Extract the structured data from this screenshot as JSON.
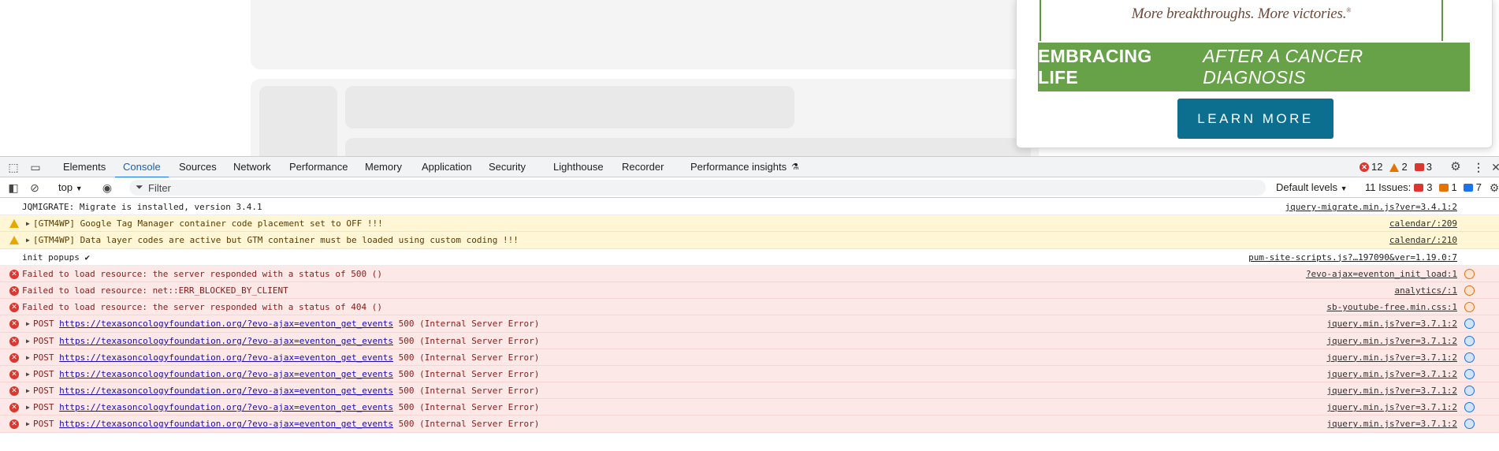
{
  "ad": {
    "tagline": "More breakthroughs. More victories.",
    "tagline_mark": "®",
    "banner_bold": "EMBRACING LIFE",
    "banner_italic": "AFTER A CANCER DIAGNOSIS",
    "cta": "LEARN MORE"
  },
  "devtools": {
    "tabs": [
      {
        "label": "Elements",
        "active": false
      },
      {
        "label": "Console",
        "active": true
      },
      {
        "label": "Sources",
        "active": false
      },
      {
        "label": "Network",
        "active": false
      },
      {
        "label": "Performance",
        "active": false
      },
      {
        "label": "Memory",
        "active": false
      },
      {
        "label": "Application",
        "active": false
      },
      {
        "label": "Security",
        "active": false
      },
      {
        "label": "Lighthouse",
        "active": false
      },
      {
        "label": "Recorder",
        "active": false
      },
      {
        "label": "Performance insights",
        "active": false
      }
    ],
    "counts": {
      "errors": "12",
      "warnings": "2",
      "messages": "3"
    },
    "toolbar": {
      "context": "top",
      "filter_placeholder": "Filter",
      "levels": "Default levels",
      "issues_label": "11 Issues:",
      "issues_red": "3",
      "issues_orange": "1",
      "issues_blue": "7"
    },
    "console": [
      {
        "level": "info",
        "expandable": false,
        "text": "JQMIGRATE: Migrate is installed, version 3.4.1",
        "source": "jquery-migrate.min.js?ver=3.4.1:2",
        "net": ""
      },
      {
        "level": "warn",
        "expandable": true,
        "text": "[GTM4WP] Google Tag Manager container code placement set to OFF !!!",
        "source": "calendar/:209",
        "net": ""
      },
      {
        "level": "warn",
        "expandable": true,
        "text": "[GTM4WP] Data layer codes are active but GTM container must be loaded using custom coding !!!",
        "source": "calendar/:210",
        "net": ""
      },
      {
        "level": "info",
        "expandable": false,
        "text": "init popups ✔",
        "source": "pum-site-scripts.js?…197090&ver=1.19.0:7",
        "net": ""
      },
      {
        "level": "error",
        "expandable": false,
        "text": "Failed to load resource: the server responded with a status of 500 ()",
        "source": "?evo-ajax=eventon_init_load:1",
        "net": "orange"
      },
      {
        "level": "error",
        "expandable": false,
        "text": "Failed to load resource: net::ERR_BLOCKED_BY_CLIENT",
        "source": "analytics/:1",
        "net": "orange"
      },
      {
        "level": "error",
        "expandable": false,
        "text": "Failed to load resource: the server responded with a status of 404 ()",
        "source": "sb-youtube-free.min.css:1",
        "net": "orange"
      },
      {
        "level": "error",
        "expandable": true,
        "method": "POST",
        "url": "https://texasoncologyfoundation.org/?evo-ajax=eventon_get_events",
        "status": "500 (Internal Server Error)",
        "source": "jquery.min.js?ver=3.7.1:2",
        "net": "blue"
      },
      {
        "level": "error",
        "expandable": true,
        "method": "POST",
        "url": "https://texasoncologyfoundation.org/?evo-ajax=eventon_get_events",
        "status": "500 (Internal Server Error)",
        "source": "jquery.min.js?ver=3.7.1:2",
        "net": "blue"
      },
      {
        "level": "error",
        "expandable": true,
        "method": "POST",
        "url": "https://texasoncologyfoundation.org/?evo-ajax=eventon_get_events",
        "status": "500 (Internal Server Error)",
        "source": "jquery.min.js?ver=3.7.1:2",
        "net": "blue"
      },
      {
        "level": "error",
        "expandable": true,
        "method": "POST",
        "url": "https://texasoncologyfoundation.org/?evo-ajax=eventon_get_events",
        "status": "500 (Internal Server Error)",
        "source": "jquery.min.js?ver=3.7.1:2",
        "net": "blue"
      },
      {
        "level": "error",
        "expandable": true,
        "method": "POST",
        "url": "https://texasoncologyfoundation.org/?evo-ajax=eventon_get_events",
        "status": "500 (Internal Server Error)",
        "source": "jquery.min.js?ver=3.7.1:2",
        "net": "blue"
      },
      {
        "level": "error",
        "expandable": true,
        "method": "POST",
        "url": "https://texasoncologyfoundation.org/?evo-ajax=eventon_get_events",
        "status": "500 (Internal Server Error)",
        "source": "jquery.min.js?ver=3.7.1:2",
        "net": "blue"
      },
      {
        "level": "error",
        "expandable": true,
        "method": "POST",
        "url": "https://texasoncologyfoundation.org/?evo-ajax=eventon_get_events",
        "status": "500 (Internal Server Error)",
        "source": "jquery.min.js?ver=3.7.1:2",
        "net": "blue"
      }
    ],
    "prompt": "›"
  }
}
